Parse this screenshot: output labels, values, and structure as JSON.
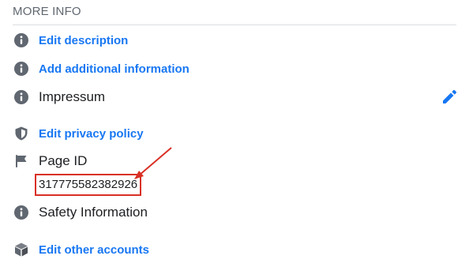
{
  "section": {
    "title": "MORE INFO"
  },
  "items": {
    "edit_description": {
      "label": "Edit description",
      "icon": "info-icon"
    },
    "add_additional_info": {
      "label": "Add additional information",
      "icon": "info-icon"
    },
    "impressum": {
      "label": "Impressum",
      "icon": "info-icon"
    },
    "edit_privacy_policy": {
      "label": "Edit privacy policy",
      "icon": "shield-icon"
    },
    "page_id": {
      "label": "Page ID",
      "value": "317775582382926",
      "icon": "flag-icon"
    },
    "safety_information": {
      "label": "Safety Information",
      "icon": "info-icon"
    },
    "edit_other_accounts": {
      "label": "Edit other accounts",
      "icon": "cube-icon"
    }
  },
  "colors": {
    "link": "#1877f2",
    "icon_gray": "#606770",
    "annotation_red": "#d93025"
  }
}
